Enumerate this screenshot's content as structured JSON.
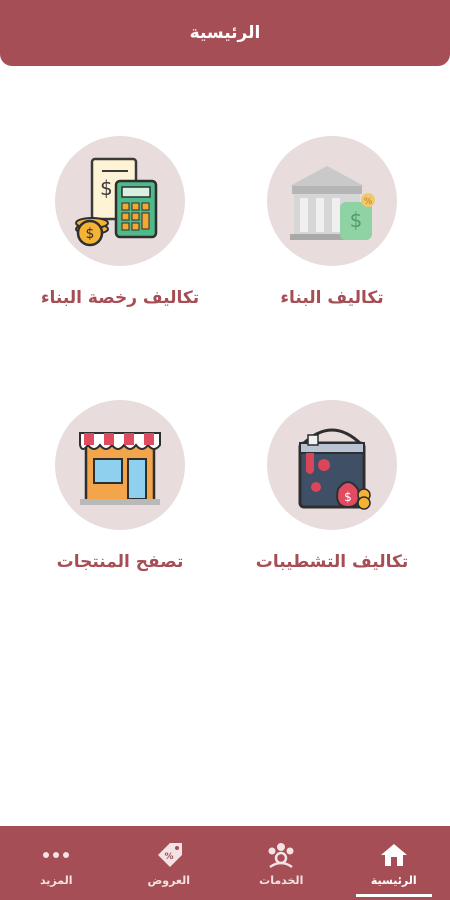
{
  "header": {
    "title": "الرئيسية"
  },
  "tiles": [
    {
      "label": "تكاليف البناء",
      "icon": "building-cost-icon"
    },
    {
      "label": "تكاليف رخصة البناء",
      "icon": "license-calculator-icon"
    },
    {
      "label": "تكاليف التشطيبات",
      "icon": "paint-bucket-icon"
    },
    {
      "label": "تصفح المنتجات",
      "icon": "storefront-icon"
    }
  ],
  "nav": {
    "items": [
      {
        "label": "الرئيسية",
        "icon": "home-icon",
        "active": true
      },
      {
        "label": "الخدمات",
        "icon": "services-icon",
        "active": false
      },
      {
        "label": "العروض",
        "icon": "offers-tag-icon",
        "active": false
      },
      {
        "label": "المزيد",
        "icon": "more-dots-icon",
        "active": false
      }
    ]
  },
  "colors": {
    "primary": "#a64e55",
    "circle": "#e8dcdc"
  }
}
